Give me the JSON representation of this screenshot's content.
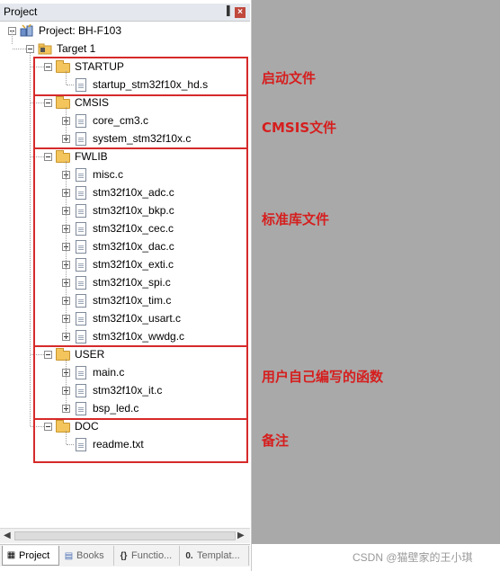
{
  "panel": {
    "title": "Project",
    "pin_glyph": "▐",
    "close_glyph": "×"
  },
  "tree": {
    "project": "Project: BH-F103",
    "target": "Target 1",
    "groups": [
      {
        "name": "STARTUP",
        "files": [
          "startup_stm32f10x_hd.s"
        ]
      },
      {
        "name": "CMSIS",
        "files": [
          "core_cm3.c",
          "system_stm32f10x.c"
        ]
      },
      {
        "name": "FWLIB",
        "files": [
          "misc.c",
          "stm32f10x_adc.c",
          "stm32f10x_bkp.c",
          "stm32f10x_cec.c",
          "stm32f10x_dac.c",
          "stm32f10x_exti.c",
          "stm32f10x_spi.c",
          "stm32f10x_tim.c",
          "stm32f10x_usart.c",
          "stm32f10x_wwdg.c"
        ]
      },
      {
        "name": "USER",
        "files": [
          "main.c",
          "stm32f10x_it.c",
          "bsp_led.c"
        ]
      },
      {
        "name": "DOC",
        "files": [
          "readme.txt"
        ]
      }
    ]
  },
  "annotations": [
    "启动文件",
    "CMSIS文件",
    "标准库文件",
    "用户自己编写的函数",
    "备注"
  ],
  "annotation_color": "#d61e1e",
  "tabs": [
    {
      "label": "Project",
      "icon": "project-tab-icon"
    },
    {
      "label": "Books",
      "icon": "books-icon"
    },
    {
      "label": "Functio...",
      "icon": "functions-icon"
    },
    {
      "label": "Templat...",
      "icon": "templates-icon"
    }
  ],
  "scroll": {
    "left": "◀",
    "right": "▶"
  },
  "watermark": "CSDN @猫壁家的王小琪"
}
